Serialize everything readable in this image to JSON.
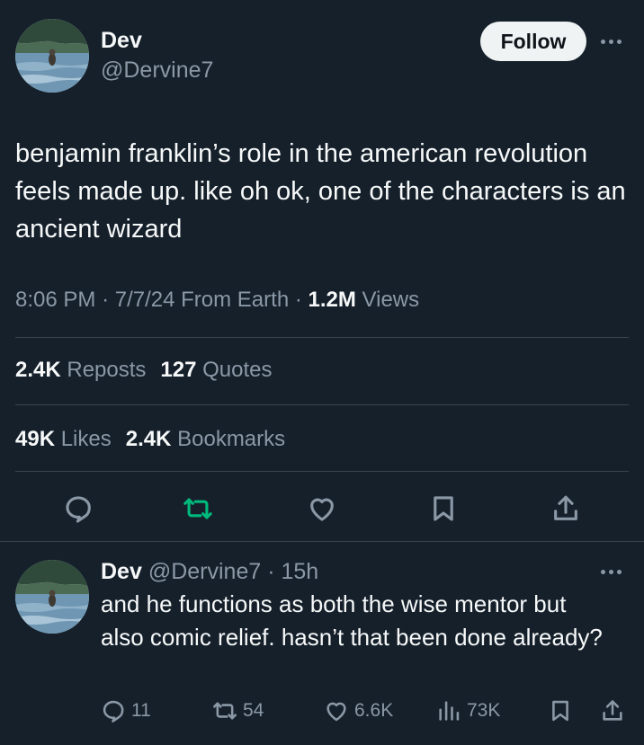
{
  "colors": {
    "background": "#15202b",
    "text": "#f7f9f9",
    "muted": "#8b98a5",
    "divider": "#38444d",
    "repost_green": "#00ba7c",
    "follow_bg": "#eff3f4"
  },
  "tweet": {
    "author_name": "Dev",
    "author_handle": "@Dervine7",
    "follow_label": "Follow",
    "more_icon": "more-horizontal-icon",
    "text": "benjamin franklin’s role in the american revolution feels made up. like oh ok, one of the characters is an ancient wizard",
    "time": "8:06 PM",
    "date": "7/7/24",
    "source": "From Earth",
    "views_count": "1.2M",
    "views_label": "Views",
    "reposts_count": "2.4K",
    "reposts_label": "Reposts",
    "quotes_count": "127",
    "quotes_label": "Quotes",
    "likes_count": "49K",
    "likes_label": "Likes",
    "bookmarks_count": "2.4K",
    "bookmarks_label": "Bookmarks",
    "actions": [
      "reply-icon",
      "repost-icon",
      "like-icon",
      "bookmark-icon",
      "share-icon"
    ]
  },
  "reply": {
    "author_name": "Dev",
    "author_handle": "@Dervine7",
    "age": "15h",
    "text": "and he functions as both the wise mentor but also comic relief. hasn’t that been done already?",
    "replies": "11",
    "reposts": "54",
    "likes": "6.6K",
    "views": "73K"
  }
}
